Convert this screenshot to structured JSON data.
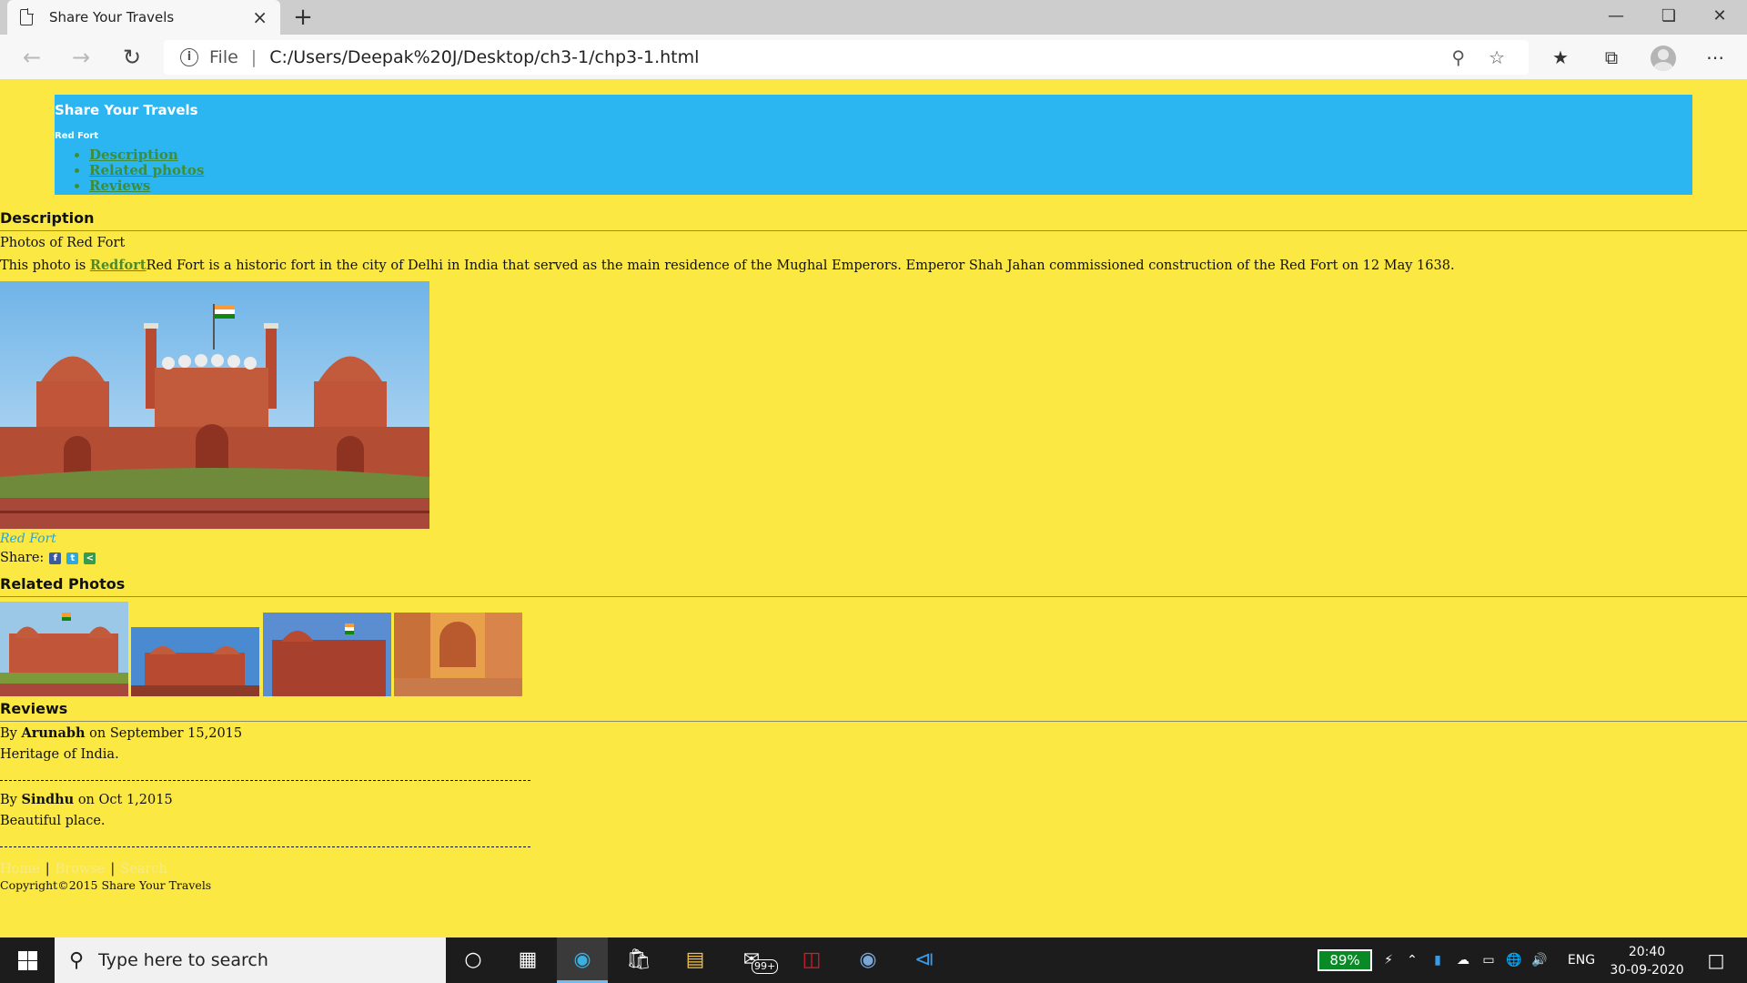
{
  "browser": {
    "tab_title": "Share Your Travels",
    "tab_close": "×",
    "new_tab": "+",
    "scheme": "File",
    "url": "C:/Users/Deepak%20J/Desktop/ch3-1/chp3-1.html",
    "icons": {
      "back": "arrow-left-icon",
      "forward": "arrow-right-icon",
      "refresh": "refresh-icon",
      "info": "info-icon",
      "zoom": "zoom-icon",
      "favorite": "star-icon",
      "favorites": "favorites-list-icon",
      "collections": "collections-icon",
      "profile": "avatar-icon",
      "more": "more-icon"
    }
  },
  "page": {
    "site_title": "Share Your Travels",
    "subtitle": "Red Fort",
    "nav": [
      "Description",
      "Related photos",
      "Reviews"
    ],
    "description_heading": "Description",
    "photos_line": "Photos of Red Fort",
    "photo_prefix": "This photo is ",
    "photo_link": "Redfort",
    "photo_text": "Red Fort is a historic fort in the city of Delhi in India that served as the main residence of the Mughal Emperors. Emperor Shah Jahan commissioned construction of the Red Fort on 12 May 1638.",
    "caption": "Red Fort",
    "share_label": "Share:",
    "related_heading": "Related Photos",
    "reviews_heading": "Reviews",
    "reviews": [
      {
        "by": "By ",
        "author": "Arunabh",
        "on": " on September 15,2015",
        "text": "Heritage of India."
      },
      {
        "by": "By ",
        "author": "Sindhu",
        "on": " on Oct 1,2015",
        "text": "Beautiful place."
      }
    ],
    "footer_links": [
      "Home",
      "Browse",
      "Search"
    ],
    "copyright": "Copyright©2015 Share Your Travels",
    "colors": {
      "page_bg": "#fbe843",
      "header_bg": "#2bb6f1",
      "link": "#3e8d3a"
    }
  },
  "taskbar": {
    "search_placeholder": "Type here to search",
    "mail_badge": "99+",
    "battery": "89%",
    "language": "ENG",
    "time": "20:40",
    "date": "30-09-2020"
  }
}
